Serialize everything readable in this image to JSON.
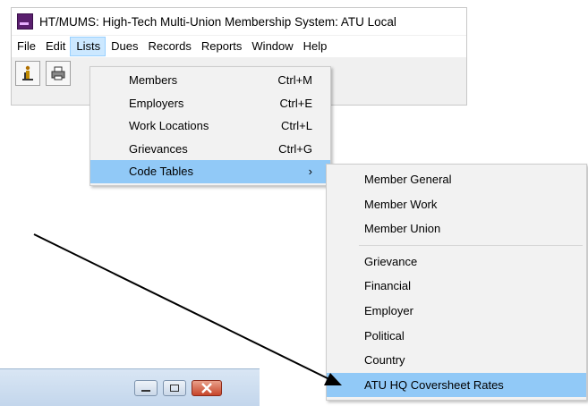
{
  "window": {
    "title": "HT/MUMS: High-Tech Multi-Union Membership System: ATU Local"
  },
  "menubar": {
    "items": [
      "File",
      "Edit",
      "Lists",
      "Dues",
      "Records",
      "Reports",
      "Window",
      "Help"
    ],
    "active": "Lists"
  },
  "lists_menu": {
    "items": [
      {
        "label": "Members",
        "shortcut": "Ctrl+M"
      },
      {
        "label": "Employers",
        "shortcut": "Ctrl+E"
      },
      {
        "label": "Work Locations",
        "shortcut": "Ctrl+L"
      },
      {
        "label": "Grievances",
        "shortcut": "Ctrl+G"
      },
      {
        "label": "Code Tables",
        "submenu_glyph": "›"
      }
    ],
    "highlighted": "Code Tables"
  },
  "code_tables_menu": {
    "group1": [
      "Member General",
      "Member Work",
      "Member Union"
    ],
    "group2": [
      "Grievance",
      "Financial",
      "Employer",
      "Political",
      "Country",
      "ATU HQ Coversheet Rates"
    ],
    "highlighted": "ATU HQ Coversheet Rates"
  },
  "colors": {
    "menu_highlight": "#91c9f7",
    "menubar_active": "#cce8ff",
    "app_icon": "#5a1f6e",
    "close_button": "#c7452a"
  },
  "icons": [
    "app-logo-icon",
    "toolbar-person-icon",
    "toolbar-printer-icon",
    "submenu-arrow-icon",
    "minimize-icon",
    "maximize-icon",
    "close-icon",
    "annotation-arrow-icon"
  ]
}
